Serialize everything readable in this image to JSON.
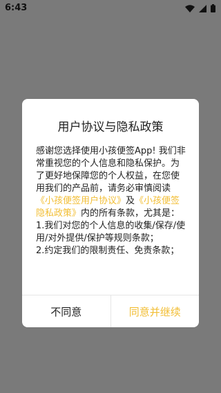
{
  "status_bar": {
    "time": "6:43",
    "icons": [
      "wifi-icon",
      "signal-icon",
      "battery-icon"
    ]
  },
  "dialog": {
    "title": "用户协议与隐私政策",
    "body": {
      "intro": "感谢您选择使用小孩便签App! 我们非常重视您的个人信息和隐私保护。为了更好地保障您的个人权益，在您使用我们的产品前，请务必审慎阅读",
      "user_agreement_link": "《小孩便签用户协议》",
      "and": "及",
      "privacy_policy_link": "《小孩便签隐私政策》",
      "after_links": "内的所有条款，尤其是：",
      "item1": "1.我们对您的个人信息的收集/保存/使用/对外提供/保护等规则条款；",
      "item2": "2.约定我们的限制责任、免责条款；"
    },
    "disagree_label": "不同意",
    "agree_label": "同意并继续"
  },
  "colors": {
    "accent": "#f2be35",
    "overlay": "#7a7a7a",
    "dialog_bg": "#ffffff"
  }
}
